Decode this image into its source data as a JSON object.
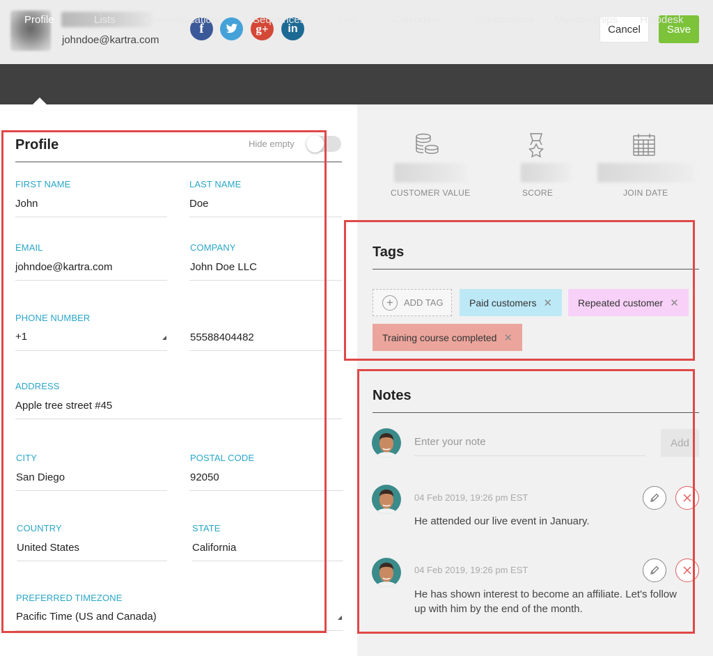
{
  "header": {
    "email": "johndoe@kartra.com",
    "social": [
      {
        "name": "facebook-icon",
        "glyph": "f"
      },
      {
        "name": "twitter-icon",
        "glyph": "t"
      },
      {
        "name": "google-plus-icon",
        "glyph": "g+"
      },
      {
        "name": "linkedin-icon",
        "glyph": "in"
      }
    ],
    "cancel_label": "Cancel",
    "save_label": "Save"
  },
  "nav": {
    "tabs": [
      "Profile",
      "Lists",
      "Communications",
      "Sequences",
      "Log",
      "Calendars",
      "Transactions",
      "Memberships",
      "Helpdesk"
    ],
    "active": "Profile"
  },
  "profile": {
    "title": "Profile",
    "hide_empty_label": "Hide empty",
    "hide_empty_on": false,
    "fields": {
      "first_name": {
        "label": "FIRST NAME",
        "value": "John"
      },
      "last_name": {
        "label": "LAST NAME",
        "value": "Doe"
      },
      "email": {
        "label": "EMAIL",
        "value": "johndoe@kartra.com"
      },
      "company": {
        "label": "COMPANY",
        "value": "John Doe LLC"
      },
      "phone_number": {
        "label": "PHONE NUMBER",
        "code": "+1",
        "value": "55588404482"
      },
      "address": {
        "label": "ADDRESS",
        "value": "Apple tree street #45"
      },
      "city": {
        "label": "CITY",
        "value": "San Diego"
      },
      "postal_code": {
        "label": "POSTAL CODE",
        "value": "92050"
      },
      "country": {
        "label": "COUNTRY",
        "value": "United States"
      },
      "state": {
        "label": "STATE",
        "value": "California"
      },
      "timezone": {
        "label": "PREFERRED TIMEZONE",
        "value": "Pacific Time (US and Canada)"
      }
    }
  },
  "stats": [
    {
      "label": "CUSTOMER VALUE",
      "icon": "coins-icon"
    },
    {
      "label": "SCORE",
      "icon": "award-icon"
    },
    {
      "label": "JOIN DATE",
      "icon": "calendar-icon"
    }
  ],
  "tags": {
    "title": "Tags",
    "add_label": "ADD TAG",
    "items": [
      {
        "label": "Paid customers",
        "color": "#bde9f7"
      },
      {
        "label": "Repeated customer",
        "color": "#f8d1f8"
      },
      {
        "label": "Training course completed",
        "color": "#eba59c"
      }
    ]
  },
  "notes": {
    "title": "Notes",
    "placeholder": "Enter your note",
    "add_label": "Add",
    "items": [
      {
        "time": "04 Feb 2019, 19:26 pm EST",
        "text": "He attended our live event in January."
      },
      {
        "time": "04 Feb 2019, 19:26 pm EST",
        "text": "He has shown interest to become an affiliate. Let's follow up with him by the end of the month."
      }
    ]
  },
  "colors": {
    "accent_label": "#2aa6c8",
    "save_green": "#7cc33a",
    "nav_bg": "#404040",
    "highlight_red": "#e04848"
  }
}
